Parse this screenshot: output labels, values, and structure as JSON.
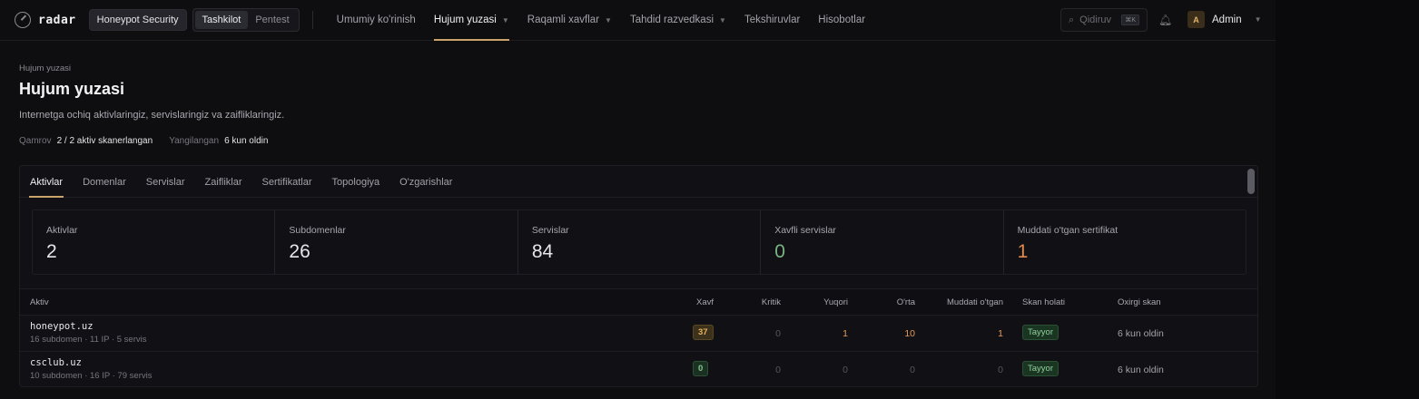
{
  "brand": "radar",
  "org": "Honeypot Security",
  "scope_toggle": [
    "Tashkilot",
    "Pentest"
  ],
  "nav": [
    {
      "label": "Umumiy ko'rinish"
    },
    {
      "label": "Hujum yuzasi",
      "dropdown": true
    },
    {
      "label": "Raqamli xavflar",
      "dropdown": true
    },
    {
      "label": "Tahdid razvedkasi",
      "dropdown": true
    },
    {
      "label": "Tekshiruvlar"
    },
    {
      "label": "Hisobotlar"
    }
  ],
  "search": {
    "placeholder": "Qidiruv",
    "shortcut": "⌘K"
  },
  "user": {
    "initial": "A",
    "name": "Admin"
  },
  "page": {
    "breadcrumb": "Hujum yuzasi",
    "title": "Hujum yuzasi",
    "subtitle": "Internetga ochiq aktivlaringiz, servislaringiz va zaifliklaringiz.",
    "coverage_label": "Qamrov",
    "coverage_value": "2 / 2 aktiv skanerlangan",
    "updated_label": "Yangilangan",
    "updated_value": "6 kun oldin"
  },
  "tabs": [
    "Aktivlar",
    "Domenlar",
    "Servislar",
    "Zaifliklar",
    "Sertifikatlar",
    "Topologiya",
    "O'zgarishlar"
  ],
  "stats": [
    {
      "label": "Aktivlar",
      "value": "2"
    },
    {
      "label": "Subdomenlar",
      "value": "26"
    },
    {
      "label": "Servislar",
      "value": "84"
    },
    {
      "label": "Xavfli servislar",
      "value": "0"
    },
    {
      "label": "Muddati o'tgan sertifikat",
      "value": "1"
    }
  ],
  "table": {
    "headers": {
      "asset": "Aktiv",
      "risk": "Xavf",
      "critical": "Kritik",
      "high": "Yuqori",
      "medium": "O'rta",
      "expired": "Muddati o'tgan",
      "scan_status": "Skan holati",
      "last_scan": "Oxirgi skan"
    },
    "rows": [
      {
        "name": "honeypot.uz",
        "sub": "16 subdomen · 11 IP · 5 servis",
        "risk": "37",
        "critical": "0",
        "high": "1",
        "medium": "10",
        "expired": "1",
        "status": "Tayyor",
        "last": "6 kun oldin"
      },
      {
        "name": "csclub.uz",
        "sub": "10 subdomen · 16 IP · 79 servis",
        "risk": "0",
        "critical": "0",
        "high": "0",
        "medium": "0",
        "expired": "0",
        "status": "Tayyor",
        "last": "6 kun oldin"
      }
    ]
  }
}
